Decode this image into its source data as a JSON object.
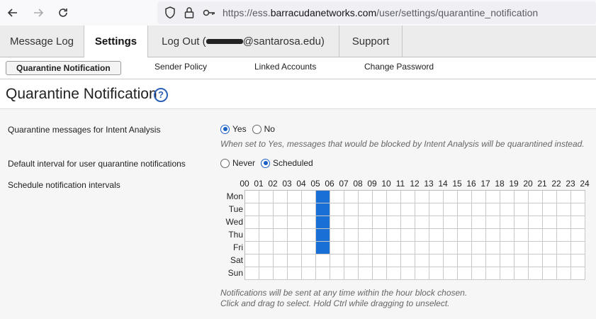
{
  "browser": {
    "url_prefix": "https://ess.",
    "url_domain": "barracudanetworks.com",
    "url_path": "/user/settings/quarantine_notification",
    "icons": [
      "back-arrow-icon",
      "forward-arrow-icon",
      "reload-icon",
      "shield-icon",
      "lock-icon",
      "key-icon"
    ]
  },
  "tabs": {
    "message_log": "Message Log",
    "settings": "Settings",
    "logout_prefix": "Log Out (",
    "logout_suffix": "@santarosa.edu)",
    "support": "Support"
  },
  "subnav": {
    "quarantine_notification": "Quarantine Notification",
    "sender_policy": "Sender Policy",
    "linked_accounts": "Linked Accounts",
    "change_password": "Change Password"
  },
  "page": {
    "title": "Quarantine Notification",
    "help": "?"
  },
  "settings": {
    "intent_label": "Quarantine messages for Intent Analysis",
    "intent_yes": "Yes",
    "intent_no": "No",
    "intent_selected": "Yes",
    "intent_hint": "When set to Yes, messages that would be blocked by Intent Analysis will be quarantined instead.",
    "interval_label": "Default interval for user quarantine notifications",
    "interval_never": "Never",
    "interval_scheduled": "Scheduled",
    "interval_selected": "Scheduled",
    "schedule_label": "Schedule notification intervals",
    "hint_1": "Notifications will be sent at any time within the hour block chosen.",
    "hint_2": "Click and drag to select. Hold Ctrl while dragging to unselect."
  },
  "schedule": {
    "hours": [
      "00",
      "01",
      "02",
      "03",
      "04",
      "05",
      "06",
      "07",
      "08",
      "09",
      "10",
      "11",
      "12",
      "13",
      "14",
      "15",
      "16",
      "17",
      "18",
      "19",
      "20",
      "21",
      "22",
      "23",
      "24"
    ],
    "days": [
      "Mon",
      "Tue",
      "Wed",
      "Thu",
      "Fri",
      "Sat",
      "Sun"
    ],
    "selected": {
      "Mon": [
        5
      ],
      "Tue": [
        5
      ],
      "Wed": [
        5
      ],
      "Thu": [
        5
      ],
      "Fri": [
        5
      ],
      "Sat": [],
      "Sun": []
    }
  },
  "colors": {
    "accent": "#1a6fd6",
    "radio": "#1a5fc4"
  }
}
